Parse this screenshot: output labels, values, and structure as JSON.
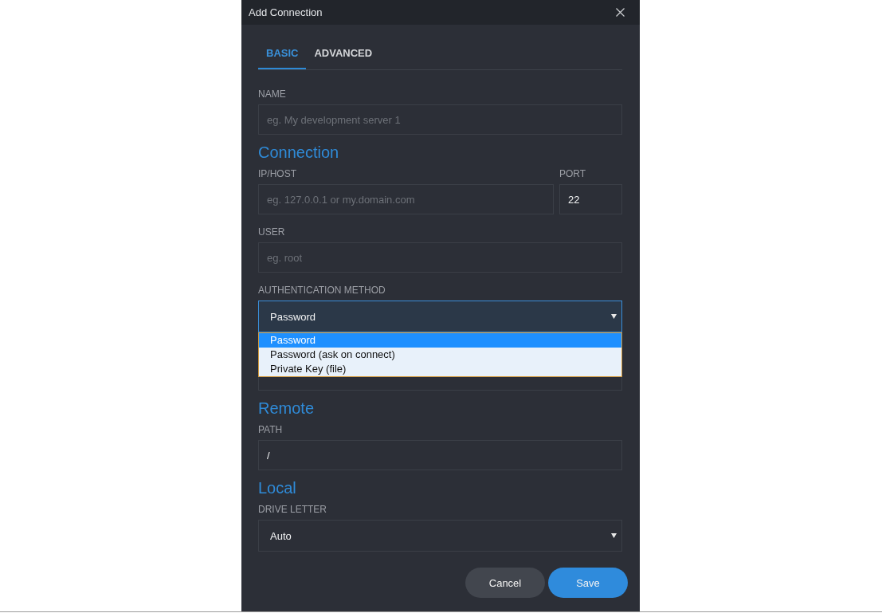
{
  "window": {
    "title": "Add Connection"
  },
  "tabs": [
    {
      "label": "BASIC",
      "selected": true
    },
    {
      "label": "ADVANCED",
      "selected": false
    }
  ],
  "name": {
    "label": "NAME",
    "placeholder": "eg. My development server 1"
  },
  "connection": {
    "heading": "Connection",
    "host": {
      "label": "IP/HOST",
      "placeholder": "eg. 127.0.0.1 or my.domain.com"
    },
    "port": {
      "label": "PORT",
      "value": "22"
    },
    "user": {
      "label": "USER",
      "placeholder": "eg. root"
    },
    "authentication_method": {
      "label": "AUTHENTICATION METHOD",
      "value": "Password",
      "expanded": true,
      "options": [
        {
          "label": "Password",
          "selected": true
        },
        {
          "label": "Password (ask on connect)",
          "selected": false
        },
        {
          "label": "Private Key (file)",
          "selected": false
        }
      ]
    }
  },
  "remote": {
    "heading": "Remote",
    "path": {
      "label": "PATH",
      "value": "/"
    }
  },
  "local": {
    "heading": "Local",
    "drive_letter": {
      "label": "DRIVE LETTER",
      "value": "Auto"
    }
  },
  "buttons": [
    {
      "label": "Cancel",
      "kind": "secondary"
    },
    {
      "label": "Save",
      "kind": "primary"
    }
  ]
}
